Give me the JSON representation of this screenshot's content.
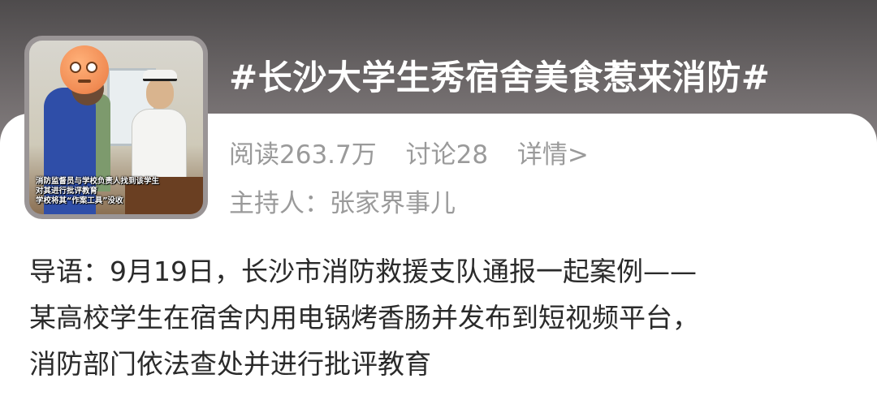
{
  "topic": {
    "title": "#长沙大学生秀宿舍美食惹来消防#",
    "reads": "阅读263.7万",
    "discussions": "讨论28",
    "detail_link": "详情>",
    "host": "主持人：张家界事儿"
  },
  "thumbnail": {
    "caption_lines": [
      "消防监督员与学校负责人找到该学生",
      "对其进行批评教育",
      "学校将其“作案工具”没收"
    ]
  },
  "intro": {
    "lines": [
      "导语：9月19日，长沙市消防救援支队通报一起案例——",
      "某高校学生在宿舍内用电锅烤香肠并发布到短视频平台，",
      "消防部门依法查处并进行批评教育"
    ]
  }
}
